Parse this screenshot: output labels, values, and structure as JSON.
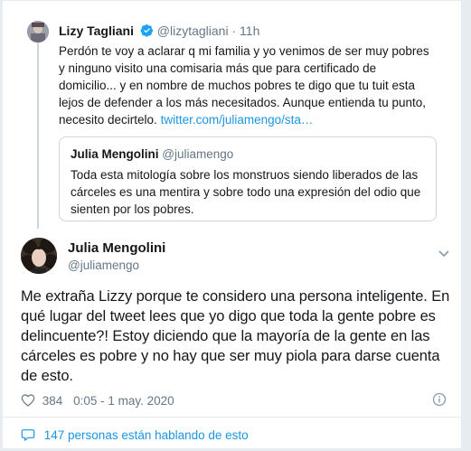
{
  "parent_tweet": {
    "name": "Lizy Tagliani",
    "handle": "@lizytagliani",
    "time": "11h",
    "separator": "·",
    "text": "Perdón te voy a aclarar q mi familia y yo venimos de ser muy pobres y ninguno visito una comisaria más que para certificado de domicilio... y en nombre de muchos pobres te digo que tu tuit esta lejos de defender a los más necesitados. Aunque entienda tu punto, necesito decirtelo.",
    "link": "twitter.com/juliamengo/sta…"
  },
  "quoted_tweet": {
    "name": "Julia Mengolini",
    "handle": "@juliamengo",
    "text": "Toda esta mitología sobre los monstruos siendo liberados de las cárceles es una mentira y sobre todo una expresión del odio que sienten por los pobres."
  },
  "main_tweet": {
    "name": "Julia Mengolini",
    "handle": "@juliamengo",
    "text": "Me extraña Lizzy porque te considero una persona inteligente. En qué lugar del tweet lees que yo digo que toda la gente pobre es delincuente?! Estoy diciendo que la mayoría de la gente en las cárceles es pobre y no hay que ser muy piola para darse cuenta de esto.",
    "likes": "384",
    "timestamp": "0:05 - 1 may. 2020"
  },
  "conversation": {
    "talking_text": "147 personas están hablando de esto"
  },
  "colors": {
    "link": "#1b95e0",
    "secondary_text": "#657786",
    "border": "#ccd6dd"
  },
  "icons": [
    "verified-badge-icon",
    "chevron-down-icon",
    "heart-icon",
    "info-icon",
    "comment-bubble-icon"
  ]
}
